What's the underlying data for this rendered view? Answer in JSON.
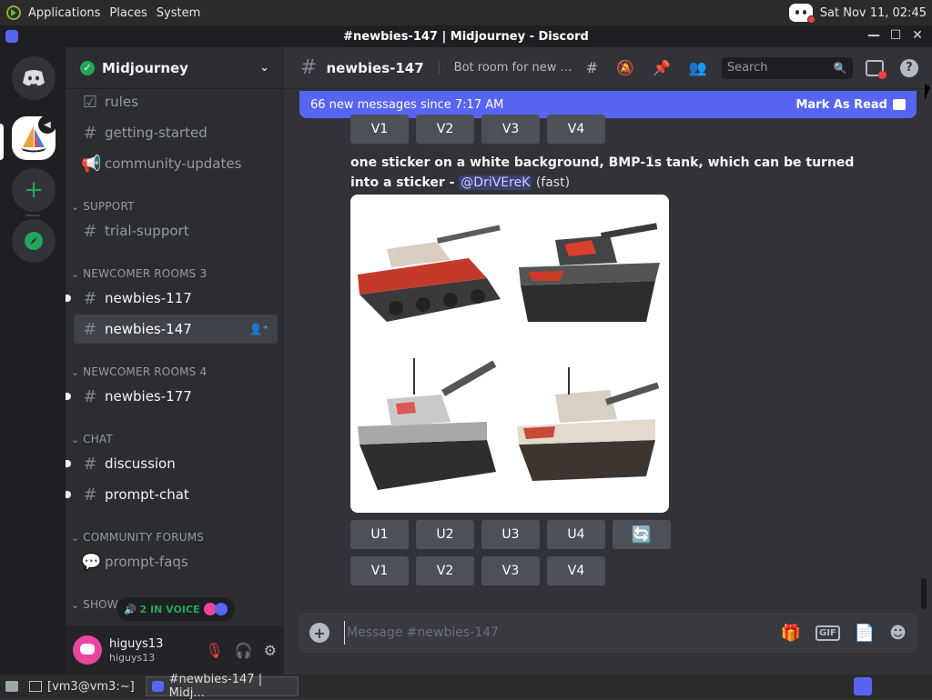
{
  "system_bar": {
    "menus": [
      "Applications",
      "Places",
      "System"
    ],
    "clock": "Sat Nov 11, 02:45"
  },
  "window": {
    "title": "#newbies-147 | Midjourney - Discord",
    "buttons": [
      "—",
      "☐",
      "✕"
    ]
  },
  "server": {
    "name": "Midjourney"
  },
  "channels": {
    "rules": "rules",
    "getting_started": "getting-started",
    "community_updates": "community-updates",
    "cat_support": "SUPPORT",
    "trial_support": "trial-support",
    "cat_newcomer3": "NEWCOMER ROOMS 3",
    "newbies_117": "newbies-117",
    "newbies_147": "newbies-147",
    "cat_newcomer4": "NEWCOMER ROOMS 4",
    "newbies_177": "newbies-177",
    "cat_chat": "CHAT",
    "discussion": "discussion",
    "prompt_chat": "prompt-chat",
    "cat_forums": "COMMUNITY FORUMS",
    "prompt_faqs": "prompt-faqs",
    "cat_showcase": "SHOWC"
  },
  "voice": {
    "label": "2 IN VOICE"
  },
  "user": {
    "name": "higuys13",
    "tag": "higuys13"
  },
  "header": {
    "channel": "newbies-147",
    "topic": "Bot room for new us...",
    "search_placeholder": "Search"
  },
  "new_messages": {
    "text": "66 new messages since 7:17 AM",
    "mark_read": "Mark As Read"
  },
  "top_buttons": [
    "V1",
    "V2",
    "V3",
    "V4"
  ],
  "message": {
    "prompt": "one sticker on a white background, BMP-1s tank, which can be turned into a sticker",
    "separator": " - ",
    "mention": "@DriVEreK",
    "speed": " (fast)"
  },
  "upscale_buttons": [
    "U1",
    "U2",
    "U3",
    "U4"
  ],
  "variation_buttons": [
    "V1",
    "V2",
    "V3",
    "V4"
  ],
  "composer": {
    "placeholder": "Message #newbies-147"
  },
  "taskbar": {
    "terminal": "[vm3@vm3:~]",
    "discord": "#newbies-147 | Midj..."
  },
  "colors": {
    "accent": "#5865f2",
    "online": "#23a55a",
    "danger": "#f23f43",
    "background": "#313338"
  }
}
